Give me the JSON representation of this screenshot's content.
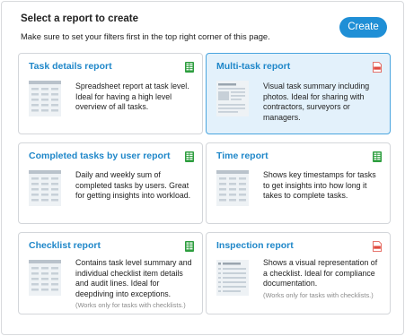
{
  "dialog": {
    "title": "Select a report to create",
    "subtitle": "Make sure to set your filters first in the top right corner of this page.",
    "create_label": "Create"
  },
  "cards": [
    {
      "title": "Task details report",
      "desc": "Spreadsheet report at task level. Ideal for having a high level overview of all tasks.",
      "note": "",
      "file_type": "xlsx-icon",
      "thumb": "table-thumbnail-icon",
      "selected": false
    },
    {
      "title": "Multi-task report",
      "desc": "Visual task summary including photos. Ideal for sharing with contractors, surveyors or managers.",
      "note": "",
      "file_type": "pdf-icon",
      "thumb": "document-thumbnail-icon",
      "selected": true
    },
    {
      "title": "Completed tasks by user report",
      "desc": "Daily and weekly sum of completed tasks by users.  Great for getting insights into workload.",
      "note": "",
      "file_type": "xlsx-icon",
      "thumb": "table-thumbnail-icon",
      "selected": false
    },
    {
      "title": "Time report",
      "desc": "Shows key timestamps for tasks to get insights into how long it takes to complete tasks.",
      "note": "",
      "file_type": "xlsx-icon",
      "thumb": "table-thumbnail-icon",
      "selected": false
    },
    {
      "title": "Checklist report",
      "desc": "Contains task level summary and individual checklist item details and audit lines. Ideal for deepdiving into exceptions.",
      "note": "(Works only for tasks with checklists.)",
      "file_type": "xlsx-icon",
      "thumb": "table-thumbnail-icon",
      "selected": false
    },
    {
      "title": "Inspection report",
      "desc": "Shows a visual representation of a checklist. Ideal for compliance documentation.",
      "note": "(Works only for tasks with checklists.)",
      "file_type": "pdf-icon",
      "thumb": "document-thumbnail-icon",
      "selected": false
    }
  ],
  "colors": {
    "accent": "#1f8fd6",
    "card_title": "#1f87c9",
    "selected_bg": "#e3f1fb",
    "selected_border": "#4aa5df",
    "xlsx_green": "#2e9e3f",
    "pdf_red": "#e04a3f"
  }
}
